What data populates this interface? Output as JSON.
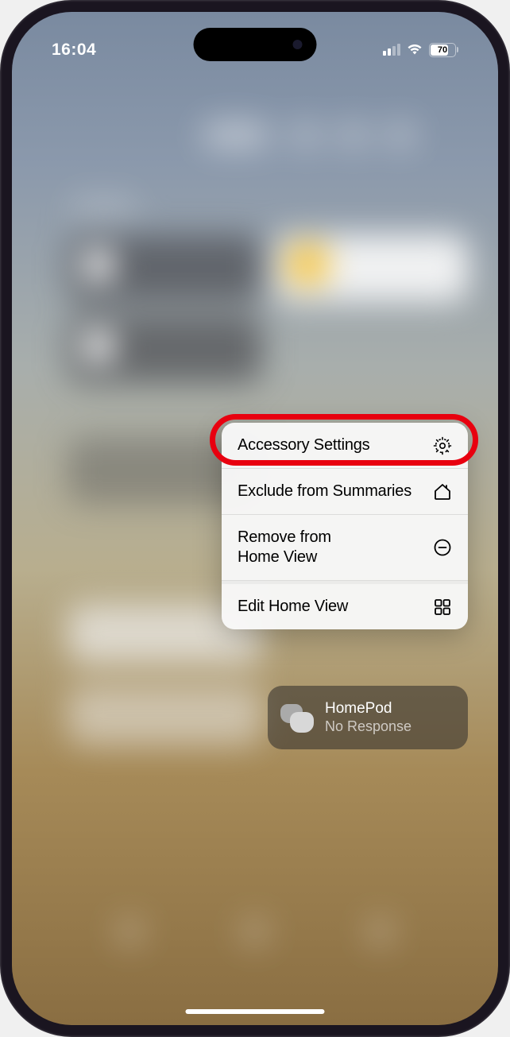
{
  "statusBar": {
    "time": "16:04",
    "battery": "70"
  },
  "menu": {
    "items": [
      {
        "label": "Accessory Settings",
        "icon": "gear"
      },
      {
        "label": "Exclude from Summaries",
        "icon": "home"
      },
      {
        "label": "Remove from\nHome View",
        "icon": "minus-circle"
      },
      {
        "label": "Edit Home View",
        "icon": "grid"
      }
    ]
  },
  "accessory": {
    "name": "HomePod",
    "status": "No Response"
  }
}
